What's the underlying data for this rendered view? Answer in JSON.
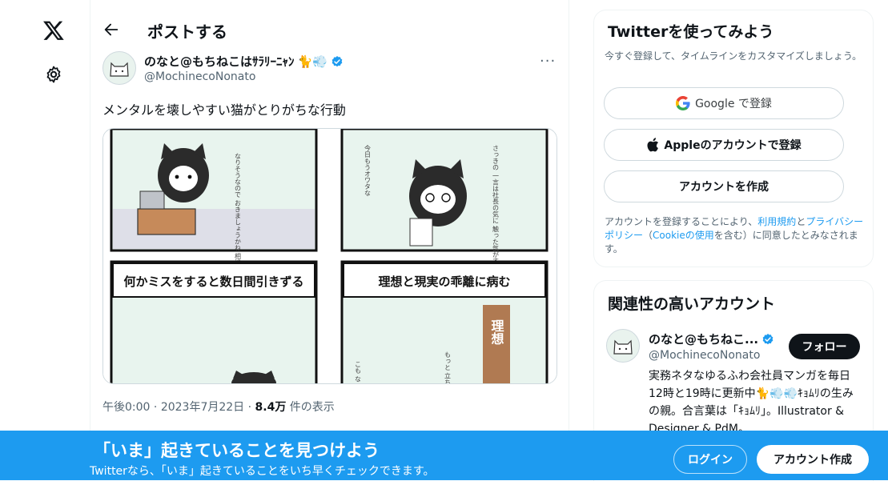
{
  "header": {
    "title": "ポストする"
  },
  "post": {
    "author_name": "のなと@もちねこはｻﾗﾘｰﾆｬﾝ",
    "author_emoji": "🐈💨",
    "handle": "@MochinecoNonato",
    "more_label": "···",
    "text": "メンタルを壊しやすい猫がとりがちな行動",
    "comic": {
      "panel1_text": "なりそうなので おきましょうかね 相談した しましょうか…",
      "panel2_text": "今日もうオワタな",
      "panel2_text_b": "さっきの 一言は社長の気に 触った気がする…",
      "panel3_caption": "何かミスをすると数日間引きずる",
      "panel4_caption": "理想と現実の乖離に病む",
      "panel4_sign": "理想",
      "panel4_text": "もっと 立ち回れ やれ",
      "panel4_text_b": "こも な"
    },
    "time": "午後0:00",
    "dot": "·",
    "date": "2023年7月22日",
    "views_count": "8.4万",
    "views_label": "件の表示"
  },
  "signup_card": {
    "title": "Twitterを使ってみよう",
    "subtitle": "今すぐ登録して、タイムラインをカスタマイズしましょう。",
    "google_label": "Google で登録",
    "apple_label": "Appleのアカウントで登録",
    "create_label": "アカウントを作成",
    "legal_prefix": "アカウントを登録することにより、",
    "terms_link": "利用規約",
    "legal_and": "と",
    "privacy_link": "プライバシーポリシー",
    "legal_mid": "（",
    "cookie_link": "Cookieの使用",
    "legal_suffix": "を含む）に同意したとみなされます。"
  },
  "related": {
    "title": "関連性の高いアカウント",
    "name": "のなと@もちねこ...",
    "handle": "@MochinecoNonato",
    "follow_label": "フォロー",
    "bio": "実務ネタなゆるふわ会社員マンガを毎日12時と19時に更新中🐈💨💨ｷｮﾑﾘの生みの親。合言葉は「ｷｮﾑﾘ」。Illustrator & Designer & PdM。"
  },
  "banner": {
    "title": "「いま」起きていることを見つけよう",
    "subtitle": "Twitterなら、「いま」起きていることをいち早くチェックできます。",
    "login_label": "ログイン",
    "signup_label": "アカウント作成"
  },
  "colors": {
    "accent": "#1d9bf0",
    "text": "#0f1419",
    "muted": "#536471",
    "border": "#eff3f4"
  }
}
